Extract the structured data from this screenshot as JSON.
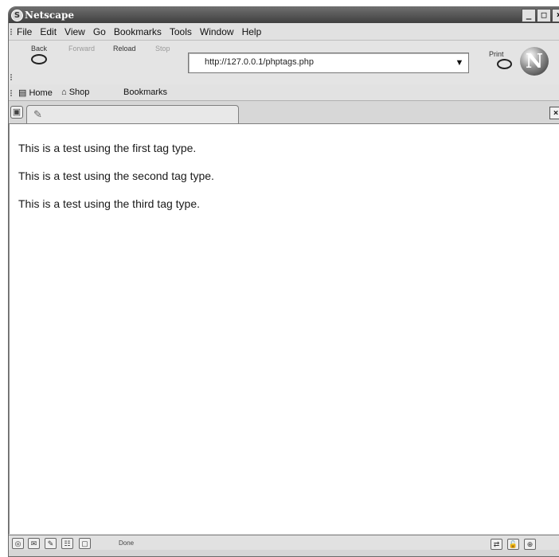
{
  "window": {
    "title": "Netscape",
    "controls": [
      "_",
      "□",
      "×"
    ]
  },
  "menu": {
    "items": [
      "File",
      "Edit",
      "View",
      "Go",
      "Bookmarks",
      "Tools",
      "Window",
      "Help"
    ]
  },
  "nav": {
    "back_label": "Back",
    "forward_label": "Forward",
    "reload_label": "Reload",
    "stop_label": "Stop",
    "print_label": "Print",
    "url": "http://127.0.0.1/phptags.php",
    "logo_letter": "N"
  },
  "bookmarks_bar": {
    "home_label": "Home",
    "shop_label": "Shop",
    "bookmarks_label": "Bookmarks"
  },
  "tabs": {
    "left_icon": "tab-page-icon",
    "tab_icon": "pin-icon",
    "close": "×"
  },
  "page": {
    "lines": [
      "This is a test using the first tag type.",
      "This is a test using the second tag type.",
      "This is a test using the third tag type."
    ]
  },
  "status": {
    "text": "Done"
  }
}
